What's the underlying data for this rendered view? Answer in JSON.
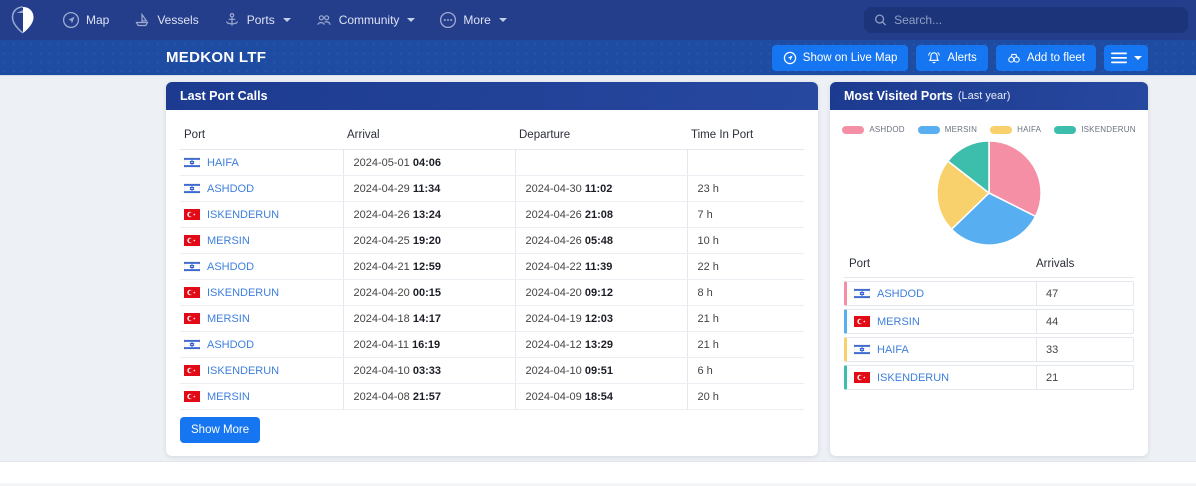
{
  "navbar": {
    "items": [
      {
        "label": "Map",
        "icon": "map-icon",
        "caret": false
      },
      {
        "label": "Vessels",
        "icon": "vessels-icon",
        "caret": false
      },
      {
        "label": "Ports",
        "icon": "ports-icon",
        "caret": true
      },
      {
        "label": "Community",
        "icon": "community-icon",
        "caret": true
      },
      {
        "label": "More",
        "icon": "more-icon",
        "caret": true
      }
    ],
    "search": {
      "placeholder": "Search...",
      "icon": "search-icon"
    }
  },
  "header": {
    "title": "MEDKON LTF",
    "actions": [
      {
        "label": "Show on Live Map",
        "icon": "live-map-icon"
      },
      {
        "label": "Alerts",
        "icon": "bell-icon"
      },
      {
        "label": "Add to fleet",
        "icon": "binoculars-icon"
      }
    ]
  },
  "port_calls": {
    "title": "Last Port Calls",
    "columns": [
      "Port",
      "Arrival",
      "Departure",
      "Time In Port"
    ],
    "rows": [
      {
        "port": "HAIFA",
        "flag": "israel-flag-icon",
        "arrival_date": "2024-05-01",
        "arrival_time": "04:06",
        "departure_date": "",
        "departure_time": "",
        "time_in_port": ""
      },
      {
        "port": "ASHDOD",
        "flag": "israel-flag-icon",
        "arrival_date": "2024-04-29",
        "arrival_time": "11:34",
        "departure_date": "2024-04-30",
        "departure_time": "11:02",
        "time_in_port": "23 h"
      },
      {
        "port": "ISKENDERUN",
        "flag": "turkey-flag-icon",
        "arrival_date": "2024-04-26",
        "arrival_time": "13:24",
        "departure_date": "2024-04-26",
        "departure_time": "21:08",
        "time_in_port": "7 h"
      },
      {
        "port": "MERSIN",
        "flag": "turkey-flag-icon",
        "arrival_date": "2024-04-25",
        "arrival_time": "19:20",
        "departure_date": "2024-04-26",
        "departure_time": "05:48",
        "time_in_port": "10 h"
      },
      {
        "port": "ASHDOD",
        "flag": "israel-flag-icon",
        "arrival_date": "2024-04-21",
        "arrival_time": "12:59",
        "departure_date": "2024-04-22",
        "departure_time": "11:39",
        "time_in_port": "22 h"
      },
      {
        "port": "ISKENDERUN",
        "flag": "turkey-flag-icon",
        "arrival_date": "2024-04-20",
        "arrival_time": "00:15",
        "departure_date": "2024-04-20",
        "departure_time": "09:12",
        "time_in_port": "8 h"
      },
      {
        "port": "MERSIN",
        "flag": "turkey-flag-icon",
        "arrival_date": "2024-04-18",
        "arrival_time": "14:17",
        "departure_date": "2024-04-19",
        "departure_time": "12:03",
        "time_in_port": "21 h"
      },
      {
        "port": "ASHDOD",
        "flag": "israel-flag-icon",
        "arrival_date": "2024-04-11",
        "arrival_time": "16:19",
        "departure_date": "2024-04-12",
        "departure_time": "13:29",
        "time_in_port": "21 h"
      },
      {
        "port": "ISKENDERUN",
        "flag": "turkey-flag-icon",
        "arrival_date": "2024-04-10",
        "arrival_time": "03:33",
        "departure_date": "2024-04-10",
        "departure_time": "09:51",
        "time_in_port": "6 h"
      },
      {
        "port": "MERSIN",
        "flag": "turkey-flag-icon",
        "arrival_date": "2024-04-08",
        "arrival_time": "21:57",
        "departure_date": "2024-04-09",
        "departure_time": "18:54",
        "time_in_port": "20 h"
      }
    ],
    "show_more_label": "Show More"
  },
  "most_visited": {
    "title": "Most Visited Ports",
    "subtitle": "(Last year)",
    "columns": [
      "Port",
      "Arrivals"
    ],
    "rows": [
      {
        "port": "ASHDOD",
        "flag": "israel-flag-icon",
        "arrivals": "47",
        "color": "#F48FA6"
      },
      {
        "port": "MERSIN",
        "flag": "turkey-flag-icon",
        "arrivals": "44",
        "color": "#57AEF0"
      },
      {
        "port": "HAIFA",
        "flag": "israel-flag-icon",
        "arrivals": "33",
        "color": "#F9D16C"
      },
      {
        "port": "ISKENDERUN",
        "flag": "turkey-flag-icon",
        "arrivals": "21",
        "color": "#3DBDAC"
      }
    ]
  },
  "chart_data": {
    "type": "pie",
    "title": "Most Visited Ports (Last year)",
    "categories": [
      "ASHDOD",
      "MERSIN",
      "HAIFA",
      "ISKENDERUN"
    ],
    "values": [
      47,
      44,
      33,
      21
    ],
    "colors": [
      "#F48FA6",
      "#57AEF0",
      "#F9D16C",
      "#3DBDAC"
    ],
    "legend_position": "top",
    "start_angle_deg": 0,
    "direction": "clockwise"
  },
  "colors": {
    "accent_button": "#1675F0",
    "topbar": "#253E8C",
    "subbar": "#1E4CA3",
    "link": "#3E7FDE"
  }
}
